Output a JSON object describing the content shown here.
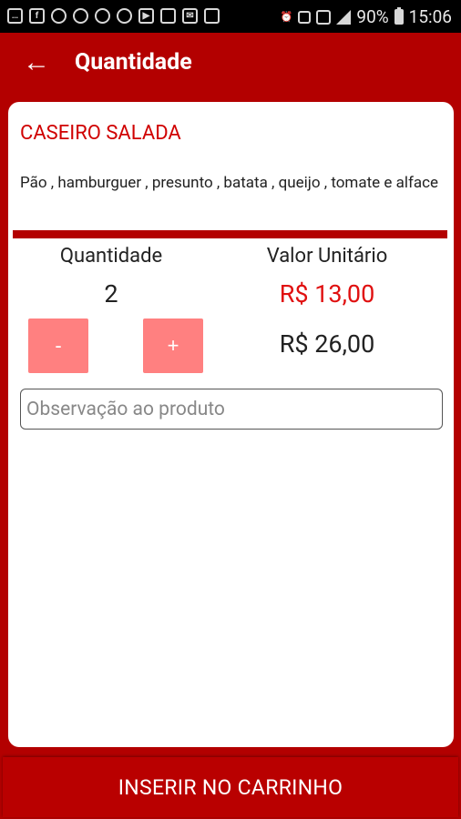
{
  "status_bar": {
    "left_icons": [
      "message-icon",
      "facebook-icon",
      "chat-icon",
      "chrome-icon",
      "circle-icon",
      "whatsapp-icon",
      "youtube-icon",
      "image-icon",
      "mail-icon",
      "app-icon"
    ],
    "battery": "90%",
    "time": "15:06"
  },
  "appbar": {
    "back_icon": "←",
    "title": "Quantidade"
  },
  "product": {
    "name": "CASEIRO SALADA",
    "description": "Pão , hamburguer , presunto , batata , queijo , tomate e alface"
  },
  "quantity": {
    "label": "Quantidade",
    "value": "2",
    "minus_label": "-",
    "plus_label": "+"
  },
  "price": {
    "unit_label": "Valor Unitário",
    "unit_value": "R$ 13,00",
    "total_value": "R$ 26,00"
  },
  "observation": {
    "placeholder": "Observação ao produto",
    "value": ""
  },
  "footer": {
    "insert_label": "INSERIR NO CARRINHO"
  },
  "colors": {
    "primary": "#b30000",
    "accent_text": "#e01010",
    "stepper": "#ff8080"
  }
}
